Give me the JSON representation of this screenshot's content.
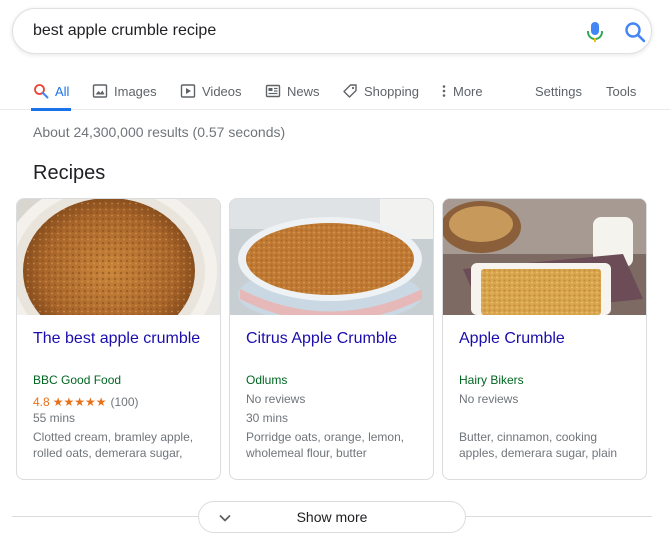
{
  "search": {
    "query": "best apple crumble recipe",
    "mic_icon": "microphone-icon",
    "search_icon": "magnifier-icon"
  },
  "tabs": [
    {
      "label": "All",
      "icon": "search-icon",
      "active": true
    },
    {
      "label": "Images",
      "icon": "image-icon"
    },
    {
      "label": "Videos",
      "icon": "play-icon"
    },
    {
      "label": "News",
      "icon": "newspaper-icon"
    },
    {
      "label": "Shopping",
      "icon": "tag-icon"
    },
    {
      "label": "More",
      "icon": "kebab-icon"
    }
  ],
  "tools": {
    "settings": "Settings",
    "tools": "Tools"
  },
  "results": {
    "stats": "About 24,300,000 results (0.57 seconds)"
  },
  "recipes": {
    "title": "Recipes",
    "cards": [
      {
        "title": "The best apple crumble",
        "source": "BBC Good Food",
        "rating": "4.8",
        "stars": "★★★★★",
        "rating_count": "(100)",
        "time": "55 mins",
        "ingredients": "Clotted cream, bramley apple, rolled oats, demerara sugar,"
      },
      {
        "title": "Citrus Apple Crumble",
        "source": "Odlums",
        "reviews": "No reviews",
        "time": "30 mins",
        "ingredients": "Porridge oats, orange, lemon, wholemeal flour, butter"
      },
      {
        "title": "Apple Crumble",
        "source": "Hairy Bikers",
        "reviews": "No reviews",
        "ingredients": "Butter, cinnamon, cooking apples, demerara sugar, plain"
      }
    ]
  },
  "show_more": {
    "label": "Show more",
    "icon": "chevron-down-icon"
  },
  "colors": {
    "link": "#1a0dab",
    "source_green": "#006621",
    "accent_blue": "#1a73e8",
    "rating_orange": "#e7711b",
    "muted": "#70757a"
  }
}
